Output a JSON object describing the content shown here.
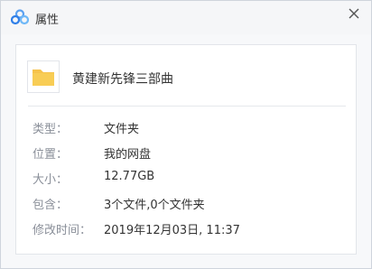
{
  "window": {
    "title": "属性"
  },
  "file": {
    "name": "黄建新先锋三部曲"
  },
  "properties": [
    {
      "label": "类型：",
      "value": "文件夹"
    },
    {
      "label": "位置：",
      "value": "我的网盘"
    },
    {
      "label": "大小：",
      "value": "12.77GB"
    },
    {
      "label": "包含：",
      "value": "3个文件,0个文件夹"
    },
    {
      "label": "修改时间：",
      "value": "2019年12月03日, 11:37"
    }
  ],
  "colors": {
    "folder": "#f6c34b",
    "accent": "#3b87f0"
  },
  "icons": {
    "app": "cloud-logo-icon",
    "close": "close-icon",
    "file": "folder-icon"
  }
}
